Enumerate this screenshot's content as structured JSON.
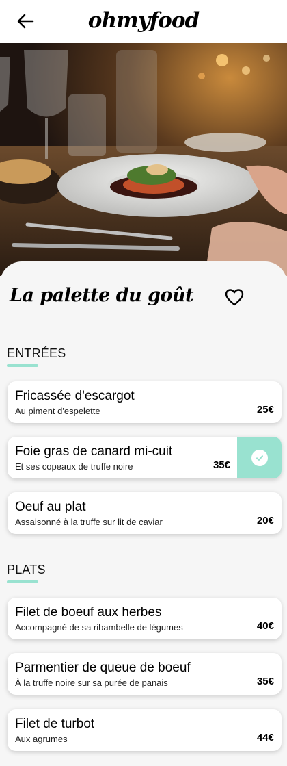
{
  "app": {
    "logo": "ohmyfood"
  },
  "header": {
    "back_icon": "arrow-left-icon"
  },
  "hero": {
    "image": "restaurant-plate-photo"
  },
  "restaurant": {
    "name": "La palette du goût",
    "favorite_icon": "heart-outline-icon"
  },
  "accent_color": "#99e2d0",
  "sections": [
    {
      "title": "ENTRÉES",
      "dishes": [
        {
          "name": "Fricassée d'escargot",
          "description": "Au piment d'espelette",
          "price": "25€",
          "selected": false
        },
        {
          "name": "Foie gras de canard mi-cuit",
          "description": "Et ses copeaux de truffe noire",
          "price": "35€",
          "selected": true
        },
        {
          "name": "Oeuf au plat",
          "description": "Assaisonné à la truffe sur lit de caviar",
          "price": "20€",
          "selected": false
        }
      ]
    },
    {
      "title": "PLATS",
      "dishes": [
        {
          "name": "Filet de boeuf aux herbes",
          "description": "Accompagné de sa ribambelle de légumes",
          "price": "40€",
          "selected": false
        },
        {
          "name": "Parmentier de queue de boeuf",
          "description": "À la truffe noire sur sa purée de panais",
          "price": "35€",
          "selected": false
        },
        {
          "name": "Filet de turbot",
          "description": "Aux agrumes",
          "price": "44€",
          "selected": false
        }
      ]
    }
  ]
}
